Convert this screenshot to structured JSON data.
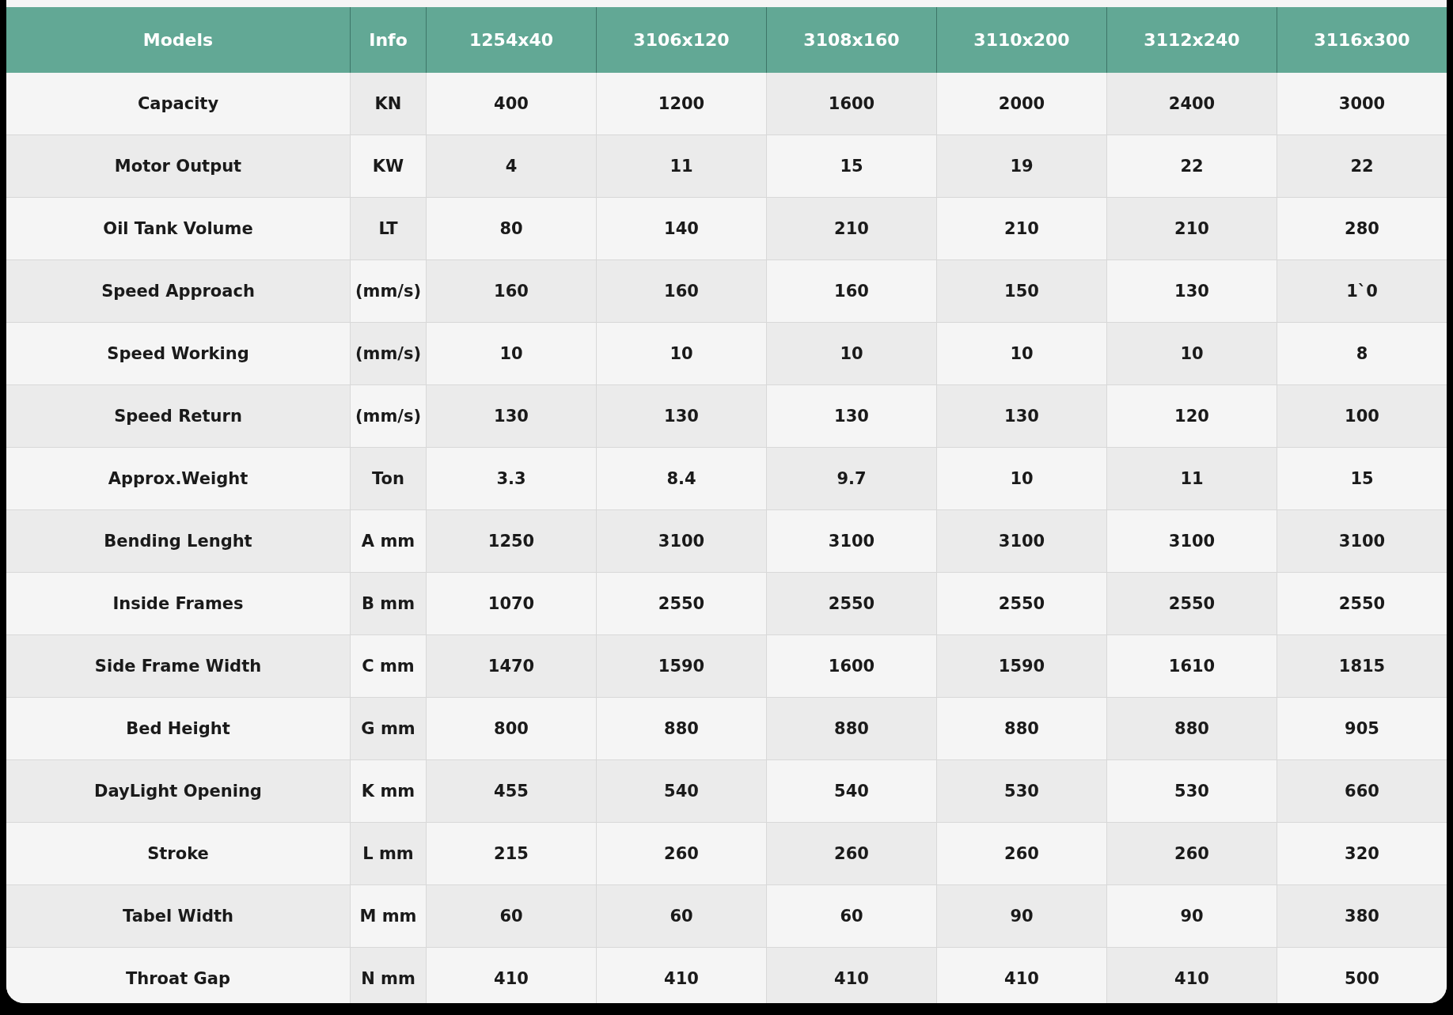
{
  "table": {
    "columns": [
      "Models",
      "Info",
      "1254x40",
      "3106x120",
      "3108x160",
      "3110x200",
      "3112x240",
      "3116x300"
    ],
    "rows": [
      {
        "label": "Capacity",
        "unit": "KN",
        "values": [
          "400",
          "1200",
          "1600",
          "2000",
          "2400",
          "3000"
        ]
      },
      {
        "label": "Motor Output",
        "unit": "KW",
        "values": [
          "4",
          "11",
          "15",
          "19",
          "22",
          "22"
        ]
      },
      {
        "label": "Oil Tank Volume",
        "unit": "LT",
        "values": [
          "80",
          "140",
          "210",
          "210",
          "210",
          "280"
        ]
      },
      {
        "label": "Speed Approach",
        "unit": "(mm/s)",
        "values": [
          "160",
          "160",
          "160",
          "150",
          "130",
          "1`0"
        ]
      },
      {
        "label": "Speed Working",
        "unit": "(mm/s)",
        "values": [
          "10",
          "10",
          "10",
          "10",
          "10",
          "8"
        ]
      },
      {
        "label": "Speed Return",
        "unit": "(mm/s)",
        "values": [
          "130",
          "130",
          "130",
          "130",
          "120",
          "100"
        ]
      },
      {
        "label": "Approx.Weight",
        "unit": "Ton",
        "values": [
          "3.3",
          "8.4",
          "9.7",
          "10",
          "11",
          "15"
        ]
      },
      {
        "label": "Bending Lenght",
        "unit": "A mm",
        "values": [
          "1250",
          "3100",
          "3100",
          "3100",
          "3100",
          "3100"
        ]
      },
      {
        "label": "Inside Frames",
        "unit": "B mm",
        "values": [
          "1070",
          "2550",
          "2550",
          "2550",
          "2550",
          "2550"
        ]
      },
      {
        "label": "Side Frame Width",
        "unit": "C mm",
        "values": [
          "1470",
          "1590",
          "1600",
          "1590",
          "1610",
          "1815"
        ]
      },
      {
        "label": "Bed Height",
        "unit": "G mm",
        "values": [
          "800",
          "880",
          "880",
          "880",
          "880",
          "905"
        ]
      },
      {
        "label": "DayLight Opening",
        "unit": "K mm",
        "values": [
          "455",
          "540",
          "540",
          "530",
          "530",
          "660"
        ]
      },
      {
        "label": "Stroke",
        "unit": "L mm",
        "values": [
          "215",
          "260",
          "260",
          "260",
          "260",
          "320"
        ]
      },
      {
        "label": "Tabel Width",
        "unit": "M mm",
        "values": [
          "60",
          "60",
          "60",
          "90",
          "90",
          "380"
        ]
      },
      {
        "label": "Throat Gap",
        "unit": "N mm",
        "values": [
          "410",
          "410",
          "410",
          "410",
          "410",
          "500"
        ]
      }
    ]
  }
}
